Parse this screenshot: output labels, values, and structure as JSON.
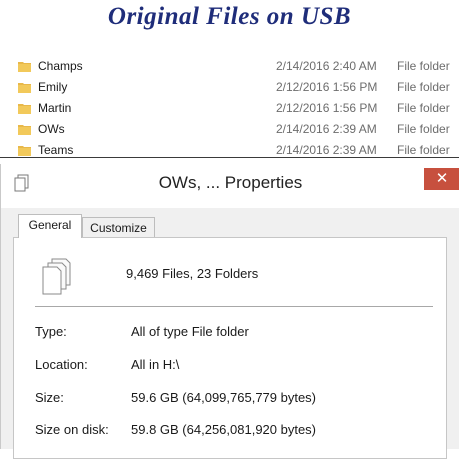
{
  "banner": {
    "title": "Original Files on USB"
  },
  "file_list": {
    "rows": [
      {
        "name": "Champs",
        "date": "2/14/2016 2:40 AM",
        "type": "File folder"
      },
      {
        "name": "Emily",
        "date": "2/12/2016 1:56 PM",
        "type": "File folder"
      },
      {
        "name": "Martin",
        "date": "2/12/2016 1:56 PM",
        "type": "File folder"
      },
      {
        "name": "OWs",
        "date": "2/14/2016 2:39 AM",
        "type": "File folder"
      },
      {
        "name": "Teams",
        "date": "2/14/2016 2:39 AM",
        "type": "File folder"
      }
    ]
  },
  "dialog": {
    "title": "OWs, ... Properties",
    "close_label": "✕",
    "tabs": [
      {
        "label": "General"
      },
      {
        "label": "Customize"
      }
    ],
    "summary": "9,469 Files, 23 Folders",
    "props": {
      "type_label": "Type:",
      "type_value": "All of type File folder",
      "location_label": "Location:",
      "location_value": "All in H:\\",
      "size_label": "Size:",
      "size_value": "59.6 GB (64,099,765,779 bytes)",
      "size_on_disk_label": "Size on disk:",
      "size_on_disk_value": "59.8 GB (64,256,081,920 bytes)"
    }
  },
  "colors": {
    "banner_text": "#1f2d7a",
    "folder_icon": "#e8b84a",
    "close_button": "#c7503e"
  },
  "icons": [
    "folder-icon",
    "properties-icon",
    "files-stack-icon",
    "close-icon"
  ]
}
